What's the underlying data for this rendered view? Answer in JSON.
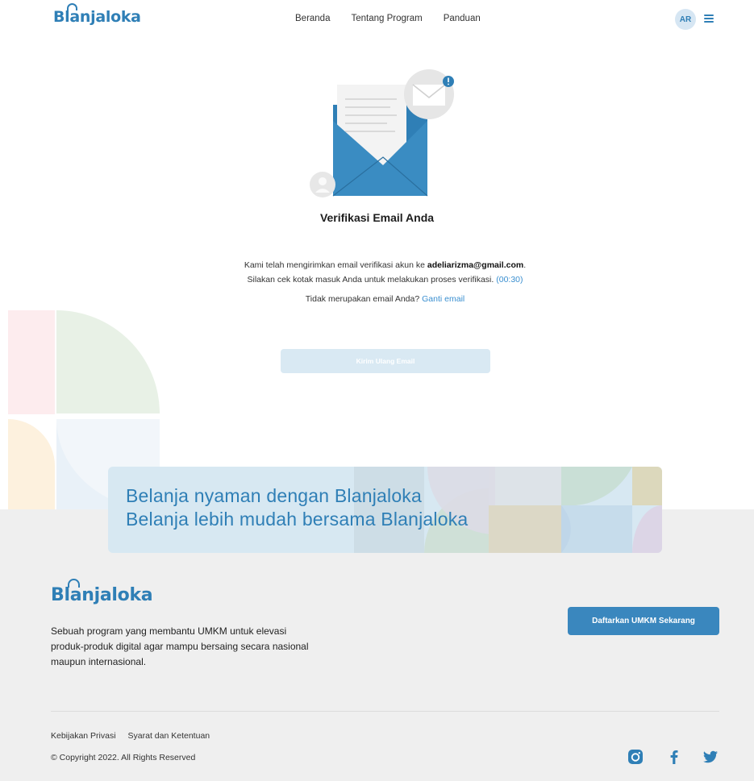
{
  "header": {
    "logo": "Blanjaloka",
    "nav": [
      "Beranda",
      "Tentang Program",
      "Panduan"
    ],
    "avatar_initials": "AR",
    "menu_icon": "hamburger-icon"
  },
  "verification": {
    "illustration": "open-envelope-with-letter-icon",
    "title": "Verifikasi Email Anda",
    "message_prefix": "Kami telah mengirimkan email verifikasi akun ke ",
    "email": "adeliarizma@gmail.com",
    "message_suffix": ".",
    "message_line2": "Silakan cek kotak masuk Anda untuk melakukan proses verifikasi.",
    "timer": "(00:30)",
    "alt_prompt": "Tidak merupakan email Anda?",
    "alt_link": "Ganti email",
    "resend_label": "Kirim Ulang Email"
  },
  "banner": {
    "line1": "Belanja nyaman dengan Blanjaloka",
    "line2": "Belanja lebih mudah bersama Blanjaloka"
  },
  "footer": {
    "logo": "Blanjaloka",
    "description": "Sebuah program yang membantu UMKM untuk elevasi produk-produk digital agar mampu bersaing secara nasional maupun internasional.",
    "cta_label": "Daftarkan UMKM Sekarang",
    "links": [
      "Kebijakan Privasi",
      "Syarat dan Ketentuan"
    ],
    "copyright": "© Copyright 2022. All Rights Reserved",
    "social": [
      "instagram-icon",
      "facebook-icon",
      "twitter-icon"
    ]
  },
  "colors": {
    "brand": "#2f7fb6",
    "link": "#3a8fd0",
    "button_disabled": "#d9e9f3",
    "cta": "#3a87be",
    "footer_bg": "#efefef"
  }
}
